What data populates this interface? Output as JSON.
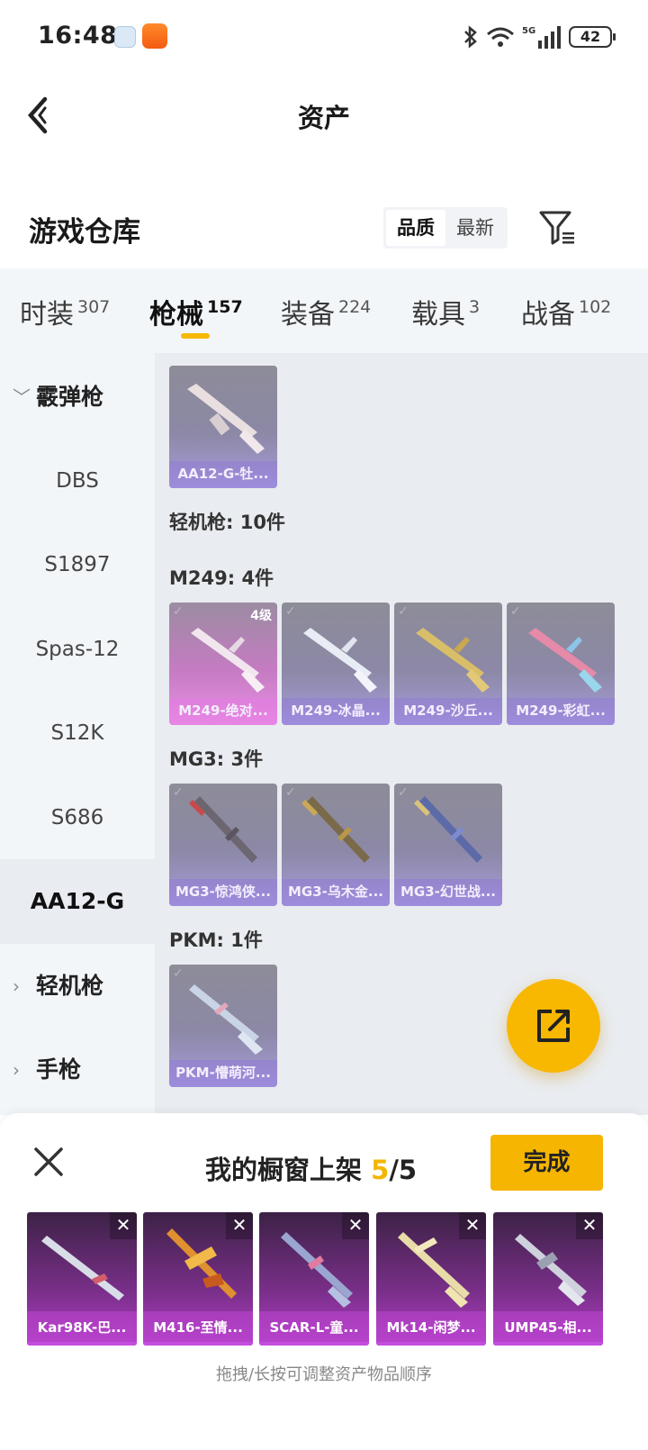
{
  "status_bar": {
    "time": "16:48",
    "battery": "42",
    "network": "5G"
  },
  "header": {
    "title": "资产"
  },
  "warehouse": {
    "title": "游戏仓库",
    "sort_quality": "品质",
    "sort_newest": "最新"
  },
  "tabs": [
    {
      "label": "时装",
      "count": "307"
    },
    {
      "label": "枪械",
      "count": "157"
    },
    {
      "label": "装备",
      "count": "224"
    },
    {
      "label": "载具",
      "count": "3"
    },
    {
      "label": "战备",
      "count": "102"
    }
  ],
  "sidebar": {
    "shotgun": "霰弹枪",
    "items": [
      "DBS",
      "S1897",
      "Spas-12",
      "S12K",
      "S686",
      "AA12-G"
    ],
    "lmg": "轻机枪",
    "pistol": "手枪"
  },
  "content": {
    "aa12_card": "AA12-G-牡...",
    "lmg_header": "轻机枪: 10件",
    "m249_header": "M249: 4件",
    "m249_cards": [
      "M249-绝对...",
      "M249-冰晶...",
      "M249-沙丘...",
      "M249-彩虹..."
    ],
    "m249_level_badge": "4级",
    "mg3_header": "MG3: 3件",
    "mg3_cards": [
      "MG3-惊鸿侠...",
      "MG3-乌木金...",
      "MG3-幻世战..."
    ],
    "pkm_header": "PKM: 1件",
    "pkm_cards": [
      "PKM-懵萌河..."
    ]
  },
  "showcase": {
    "title": "我的橱窗上架",
    "count": "5",
    "total": "/5",
    "done_label": "完成",
    "items": [
      "Kar98K-巴...",
      "M416-至情...",
      "SCAR-L-童...",
      "Mk14-闲梦...",
      "UMP45-相..."
    ],
    "hint": "拖拽/长按可调整资产物品顺序"
  }
}
